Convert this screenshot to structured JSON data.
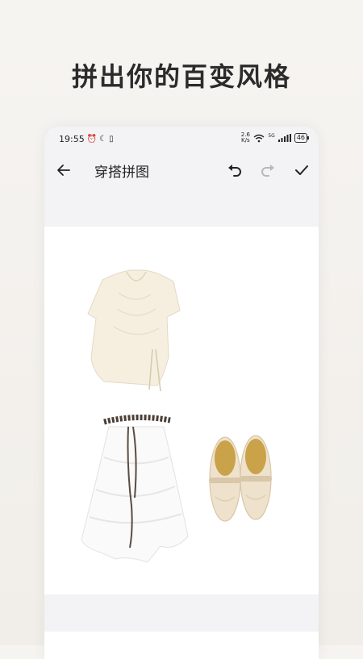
{
  "promo": {
    "headline": "拼出你的百变风格"
  },
  "status_bar": {
    "time": "19:55",
    "net_speed_value": "2.6",
    "net_speed_unit": "K/s",
    "signal_label": "5G",
    "battery_level": "46"
  },
  "toolbar": {
    "title": "穿搭拼图",
    "back_icon": "arrow-left",
    "undo_icon": "undo-arrow",
    "redo_icon": "redo-arrow",
    "confirm_icon": "checkmark"
  },
  "canvas_items": [
    "blouse",
    "skirt-with-belt",
    "flats"
  ],
  "colors": {
    "text": "#222222",
    "redo_disabled": "#b8b8b8",
    "canvas": "#ffffff",
    "phone_bg": "#f3f3f6"
  }
}
